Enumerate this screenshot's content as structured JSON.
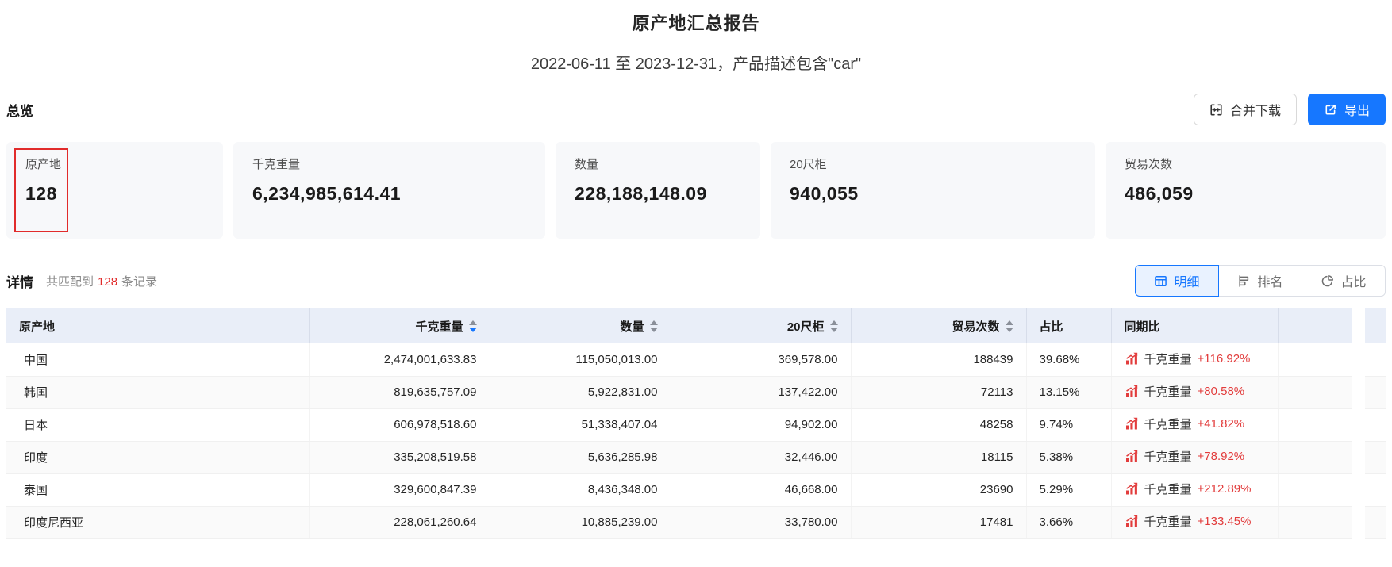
{
  "header": {
    "title": "原产地汇总报告",
    "subtitle": "2022-06-11 至 2023-12-31，产品描述包含\"car\""
  },
  "overview": {
    "heading": "总览",
    "buttons": {
      "merge_download": "合并下载",
      "export": "导出"
    },
    "cards": [
      {
        "label": "原产地",
        "value": "128"
      },
      {
        "label": "千克重量",
        "value": "6,234,985,614.41"
      },
      {
        "label": "数量",
        "value": "228,188,148.09"
      },
      {
        "label": "20尺柜",
        "value": "940,055"
      },
      {
        "label": "贸易次数",
        "value": "486,059"
      }
    ]
  },
  "details": {
    "heading": "详情",
    "match_prefix": "共匹配到",
    "match_count": "128",
    "match_suffix": "条记录",
    "tabs": [
      {
        "label": "明细",
        "icon": "table-grid-icon",
        "active": true
      },
      {
        "label": "排名",
        "icon": "ranking-icon",
        "active": false
      },
      {
        "label": "占比",
        "icon": "pie-chart-icon",
        "active": false
      }
    ]
  },
  "table": {
    "columns": [
      "原产地",
      "千克重量",
      "数量",
      "20尺柜",
      "贸易次数",
      "占比",
      "同期比"
    ],
    "sorted_column": "千克重量",
    "sort_direction": "desc",
    "rows": [
      {
        "origin": "中国",
        "kg": "2,474,001,633.83",
        "qty": "115,050,013.00",
        "teu": "369,578.00",
        "trades": "188439",
        "share": "39.68%",
        "yoy_label": "千克重量",
        "yoy_value": "+116.92%"
      },
      {
        "origin": "韩国",
        "kg": "819,635,757.09",
        "qty": "5,922,831.00",
        "teu": "137,422.00",
        "trades": "72113",
        "share": "13.15%",
        "yoy_label": "千克重量",
        "yoy_value": "+80.58%"
      },
      {
        "origin": "日本",
        "kg": "606,978,518.60",
        "qty": "51,338,407.04",
        "teu": "94,902.00",
        "trades": "48258",
        "share": "9.74%",
        "yoy_label": "千克重量",
        "yoy_value": "+41.82%"
      },
      {
        "origin": "印度",
        "kg": "335,208,519.58",
        "qty": "5,636,285.98",
        "teu": "32,446.00",
        "trades": "18115",
        "share": "5.38%",
        "yoy_label": "千克重量",
        "yoy_value": "+78.92%"
      },
      {
        "origin": "泰国",
        "kg": "329,600,847.39",
        "qty": "8,436,348.00",
        "teu": "46,668.00",
        "trades": "23690",
        "share": "5.29%",
        "yoy_label": "千克重量",
        "yoy_value": "+212.89%"
      },
      {
        "origin": "印度尼西亚",
        "kg": "228,061,260.64",
        "qty": "10,885,239.00",
        "teu": "33,780.00",
        "trades": "17481",
        "share": "3.66%",
        "yoy_label": "千克重量",
        "yoy_value": "+133.45%"
      }
    ]
  },
  "colors": {
    "accent_blue": "#1677ff",
    "annotation_red": "#e12b2b",
    "yoy_red": "#e23c3c",
    "table_header_bg": "#e9eef8",
    "card_bg": "#f7f8fa"
  }
}
